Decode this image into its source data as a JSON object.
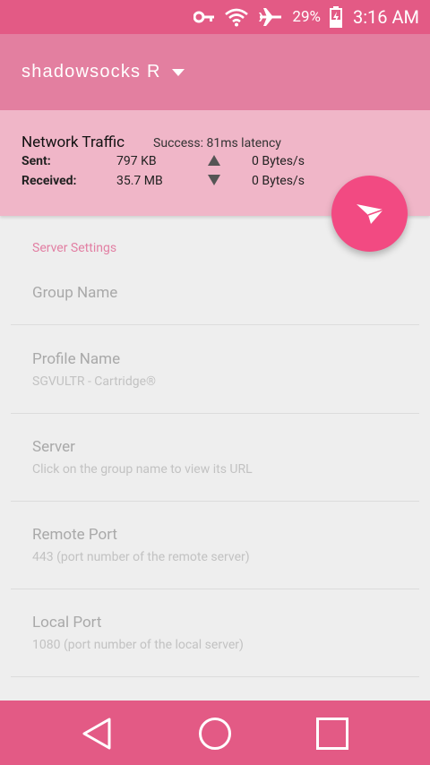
{
  "status_bar": {
    "icons": [
      "key-icon",
      "wifi-icon",
      "airplane-icon",
      "battery-icon"
    ],
    "battery_percent": "29%",
    "time": "3:16 AM"
  },
  "toolbar": {
    "title": "shadowsocks R"
  },
  "traffic": {
    "title": "Network Traffic",
    "status": "Success: 81ms latency",
    "sent_label": "Sent:",
    "sent_value": "797 KB",
    "sent_rate": "0 Bytes/s",
    "received_label": "Received:",
    "received_value": "35.7 MB",
    "received_rate": "0 Bytes/s"
  },
  "settings": {
    "section_title": "Server Settings",
    "items": [
      {
        "title": "Group Name",
        "summary": ""
      },
      {
        "title": "Profile Name",
        "summary": "SGVULTR - Cartridge®"
      },
      {
        "title": "Server",
        "summary": "Click on the group name to view its URL"
      },
      {
        "title": "Remote Port",
        "summary": "443 (port number of the remote server)"
      },
      {
        "title": "Local Port",
        "summary": "1080 (port number of the local server)"
      }
    ]
  },
  "colors": {
    "status_bar": "#e35a85",
    "toolbar": "#e37fa0",
    "traffic_panel": "#f0b6c8",
    "fab": "#f24a82",
    "accent_text": "#e27fa3"
  }
}
